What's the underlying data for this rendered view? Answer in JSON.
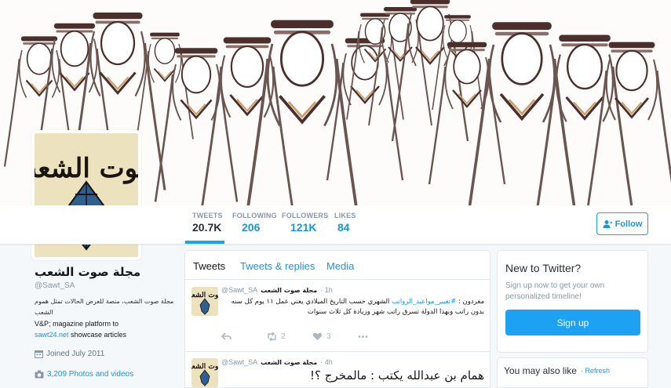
{
  "profile": {
    "name": "مجلة صوت الشعب",
    "handle": "@Sawt_SA",
    "bio_arabic": "مجلة صوت الشعب، منصة للعرض الحالات تمثل هموم الشعب",
    "bio_line2": "V&P; magazine platform to",
    "bio_link": "sawt24.net",
    "bio_line3": " showcase articles",
    "joined": "Joined July 2011",
    "photos": "3,209 Photos and videos",
    "avatar_text": "صوت الشعب"
  },
  "stats": [
    {
      "label": "TWEETS",
      "value": "20.7K"
    },
    {
      "label": "FOLLOWING",
      "value": "206"
    },
    {
      "label": "FOLLOWERS",
      "value": "121K"
    },
    {
      "label": "LIKES",
      "value": "84"
    }
  ],
  "follow_label": "Follow",
  "tabs": [
    {
      "label": "Tweets"
    },
    {
      "label": "Tweets & replies"
    },
    {
      "label": "Media"
    }
  ],
  "tweets": [
    {
      "name": "مجلة صوت الشعب",
      "handle": "@Sawt_SA",
      "time": "· 1h",
      "prefix": "مغردون : ",
      "hashtag": "#تغيير_مواعيد_الرواتب",
      "text": " الشهري حسب التاريخ الميلادي يعني عمل ١١ يوم كل سنه بدون راتب وبهذا الدولة تسرق راتب شهر وزيادة كل ثلاث سنوات",
      "retweets": "2",
      "likes": "3"
    },
    {
      "name": "مجلة صوت الشعب",
      "handle": "@Sawt_SA",
      "time": "· 4h",
      "text": "همام بن عبدالله يكتب : مالمخرج ؟!"
    }
  ],
  "new_to_twitter": {
    "title": "New to Twitter?",
    "subtitle": "Sign up now to get your own personalized timeline!",
    "button": "Sign up"
  },
  "also_like": {
    "title": "You may also like",
    "refresh": "· Refresh"
  },
  "colors": {
    "accent": "#1da1f2",
    "link": "#1b95e0",
    "avatar_bg": "#ece2be"
  }
}
